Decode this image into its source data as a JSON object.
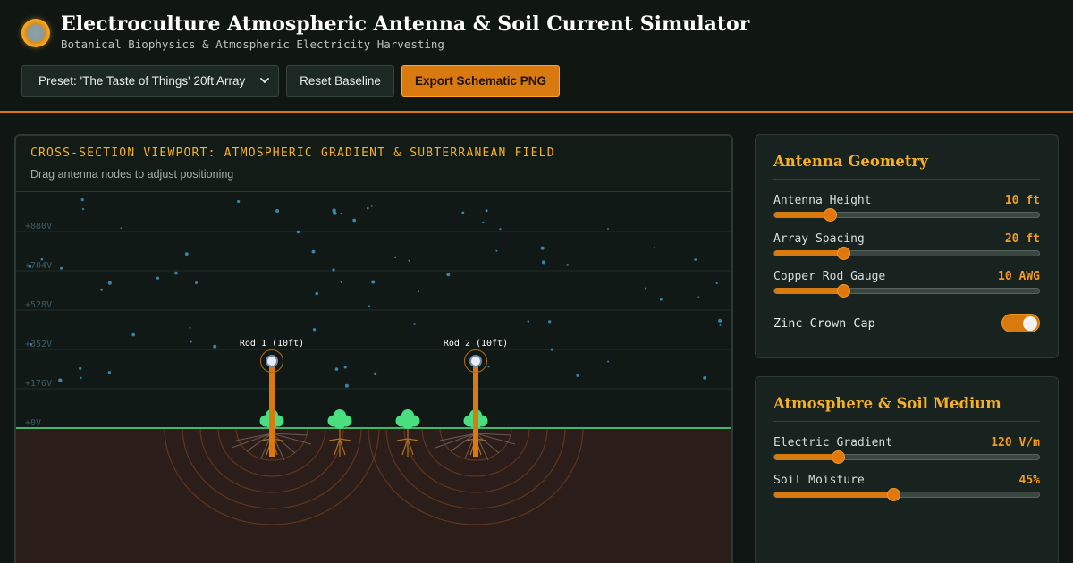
{
  "header": {
    "title": "Electroculture Atmospheric Antenna & Soil Current Simulator",
    "subtitle": "Botanical Biophysics & Atmospheric Electricity Harvesting",
    "logo_icon": "glowing-orb-icon"
  },
  "toolbar": {
    "preset_value": "Preset: 'The Taste of Things' 20ft Array",
    "reset_label": "Reset Baseline",
    "export_label": "Export Schematic PNG"
  },
  "viewport": {
    "title": "CROSS-SECTION VIEWPORT: ATMOSPHERIC GRADIENT & SUBTERRANEAN FIELD",
    "subtitle": "Drag antenna nodes to adjust positioning",
    "voltage_labels": [
      "+880V",
      "+704V",
      "+528V",
      "+352V",
      "+176V",
      "+0V"
    ],
    "antennas": [
      {
        "label": "Rod 1 (10ft)"
      },
      {
        "label": "Rod 2 (10ft)"
      }
    ],
    "plant_count": 4
  },
  "antenna_geometry": {
    "title": "Antenna Geometry",
    "controls": [
      {
        "label": "Antenna Height",
        "value": "10 ft",
        "level": 0.21
      },
      {
        "label": "Array Spacing",
        "value": "20 ft",
        "level": 0.26
      },
      {
        "label": "Copper Rod Gauge",
        "value": "10 AWG",
        "level": 0.26
      }
    ],
    "zinc_cap": {
      "label": "Zinc Crown Cap",
      "on": true
    }
  },
  "medium": {
    "title": "Atmosphere & Soil Medium",
    "controls": [
      {
        "label": "Electric Gradient",
        "value": "120 V/m",
        "level": 0.24
      },
      {
        "label": "Soil Moisture",
        "value": "45%",
        "level": 0.45
      }
    ]
  },
  "colors": {
    "accent": "#d97a10",
    "title_gold": "#f5b024",
    "ground_line": "#3fb86a",
    "soil": "#2a1d1a",
    "particle": "#4aa8d8",
    "plant": "#4ade80"
  }
}
